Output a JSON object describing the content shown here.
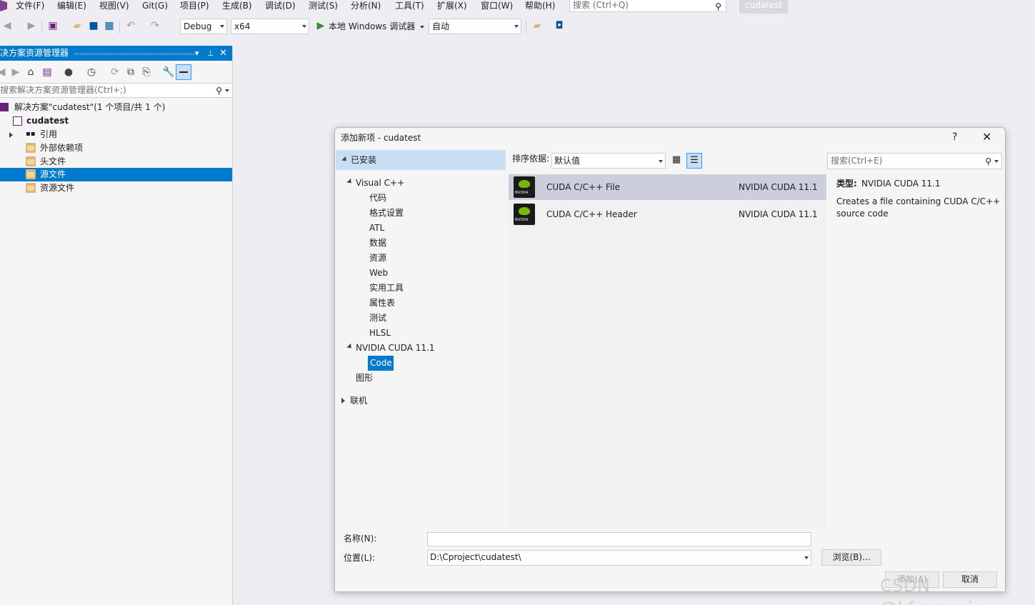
{
  "menu": {
    "items": [
      "文件(F)",
      "编辑(E)",
      "视图(V)",
      "Git(G)",
      "项目(P)",
      "生成(B)",
      "调试(D)",
      "测试(S)",
      "分析(N)",
      "工具(T)",
      "扩展(X)",
      "窗口(W)",
      "帮助(H)"
    ],
    "search_placeholder": "搜索 (Ctrl+Q)",
    "project_name": "cudatest"
  },
  "toolbar": {
    "config": "Debug",
    "platform": "x64",
    "run_label": "本地 Windows 调试器",
    "auto": "自动"
  },
  "solution_explorer": {
    "title": "决方案资源管理器",
    "search_placeholder": "搜索解决方案资源管理器(Ctrl+;)",
    "solution_label": "解决方案\"cudatest\"(1 个项目/共 1 个)",
    "project": "cudatest",
    "nodes": [
      "引用",
      "外部依赖项",
      "头文件",
      "源文件",
      "资源文件"
    ]
  },
  "dialog": {
    "title": "添加新项 - cudatest",
    "help": "?",
    "installed": "已安装",
    "tree": {
      "visual_cpp": "Visual C++",
      "visual_cpp_children": [
        "代码",
        "格式设置",
        "ATL",
        "数据",
        "资源",
        "Web",
        "实用工具",
        "属性表",
        "测试",
        "HLSL"
      ],
      "nvidia": "NVIDIA CUDA 11.1",
      "nvidia_child": "Code",
      "graphics": "图形",
      "online": "联机"
    },
    "sort_label": "排序依据:",
    "sort_value": "默认值",
    "search_placeholder": "搜索(Ctrl+E)",
    "templates": [
      {
        "name": "CUDA C/C++ File",
        "category": "NVIDIA CUDA 11.1"
      },
      {
        "name": "CUDA C/C++ Header",
        "category": "NVIDIA CUDA 11.1"
      }
    ],
    "type_label": "类型:",
    "type_value": "NVIDIA CUDA 11.1",
    "description": "Creates a file containing CUDA C/C++ source code",
    "name_label": "名称(N):",
    "name_value": "",
    "location_label": "位置(L):",
    "location_value": "D:\\Cproject\\cudatest\\",
    "browse": "浏览(B)...",
    "add": "添加(A)",
    "cancel": "取消"
  },
  "watermark": "CSDN @kframario"
}
